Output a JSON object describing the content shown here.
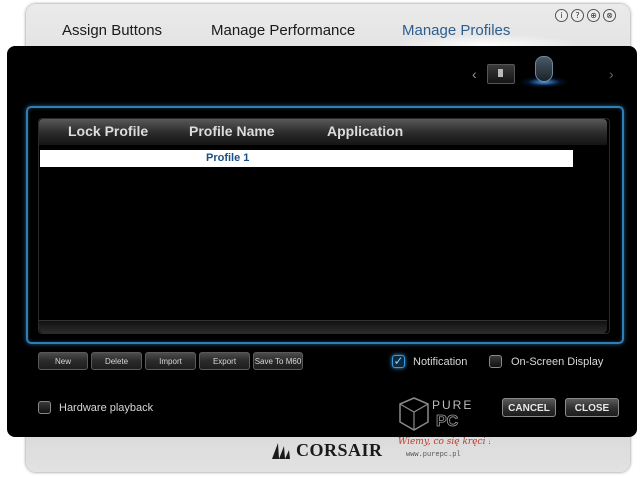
{
  "window_icons": [
    "i",
    "?",
    "⊕",
    "⊗"
  ],
  "tabs": [
    {
      "label": "Assign Buttons"
    },
    {
      "label": "Manage Performance"
    },
    {
      "label": "Manage Profiles"
    }
  ],
  "profiles_table": {
    "columns": [
      "Lock Profile",
      "Profile Name",
      "Application"
    ],
    "rows": [
      {
        "profile_name": "Profile 1"
      }
    ]
  },
  "actions": {
    "new": "New",
    "delete": "Delete",
    "import": "Import",
    "export": "Export",
    "save_to": "Save To M60"
  },
  "options": {
    "notification": "Notification",
    "osd": "On-Screen Display",
    "hardware_playback": "Hardware playback"
  },
  "buttons": {
    "cancel": "CANCEL",
    "close": "CLOSE"
  },
  "brand": "CORSAIR",
  "watermark": {
    "top": "PURE",
    "mid": "PC",
    "slogan": "Wiemy, co się kręci !",
    "url": "www.purepc.pl"
  },
  "colors": {
    "active_tab": "#2d5e8e",
    "accent_blue": "#2f7fb6",
    "panel": "#000000"
  }
}
